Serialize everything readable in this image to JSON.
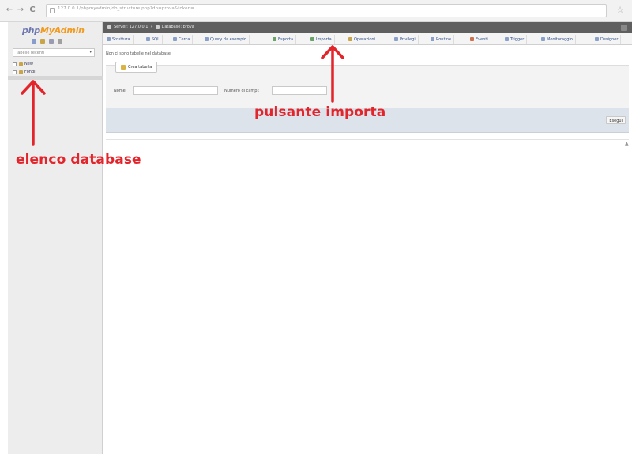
{
  "browser": {
    "back_icon": "arrow-left",
    "forward_icon": "arrow-right",
    "reload_icon": "reload",
    "back_glyph": "←",
    "forward_glyph": "→",
    "reload_glyph": "C",
    "star_glyph": "☆",
    "url": "127.0.0.1/phpmyadmin/db_structure.php?db=prova&token=..."
  },
  "sidebar": {
    "logo_php": "php",
    "logo_mya": "MyAdmin",
    "recent_select": "Tabelle recenti",
    "select_arrow": "▾",
    "tree": [
      {
        "label": "New"
      },
      {
        "label": "Fondi"
      }
    ]
  },
  "header": {
    "breadcrumb_server": "Server: 127.0.0.1",
    "breadcrumb_db": "Database: prova"
  },
  "tabs": [
    {
      "label": "Struttura",
      "color": "#7f9bd0"
    },
    {
      "label": "SQL",
      "color": "#8aa0c8"
    },
    {
      "label": "Cerca",
      "color": "#8aa0c8"
    },
    {
      "label": "Query da esempio",
      "color": "#8aa0c8"
    },
    {
      "label": "Esporta",
      "color": "#6aa36a"
    },
    {
      "label": "Importa",
      "color": "#6aa36a"
    },
    {
      "label": "Operazioni",
      "color": "#c9a54a"
    },
    {
      "label": "Privilegi",
      "color": "#8aa0c8"
    },
    {
      "label": "Routine",
      "color": "#8aa0c8"
    },
    {
      "label": "Eventi",
      "color": "#d0704a"
    },
    {
      "label": "Trigger",
      "color": "#8aa0c8"
    },
    {
      "label": "Monitoraggio",
      "color": "#8aa0c8"
    },
    {
      "label": "Designer",
      "color": "#8aa0c8"
    }
  ],
  "main": {
    "no_tables_text": "Non ci sono tabelle nel database.",
    "create_table_label": "Crea tabella",
    "name_label": "Nome:",
    "columns_label": "Numero di campi:",
    "run_button": "Esegui",
    "scroll_glyph": "▲"
  },
  "annotations": {
    "import_button": "pulsante importa",
    "database_list": "elenco database",
    "color": "#e3242b"
  }
}
